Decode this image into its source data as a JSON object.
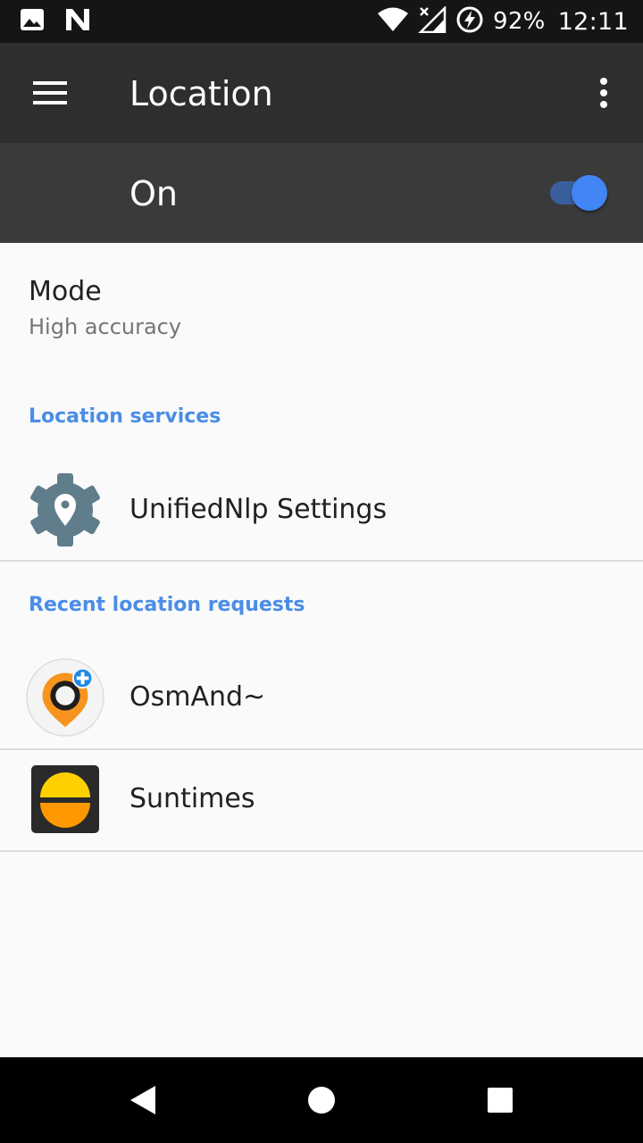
{
  "status_bar": {
    "icons": [
      "image-icon",
      "n-notification-icon",
      "wifi-icon",
      "signal-icon",
      "battery-charging-icon"
    ],
    "battery": "92%",
    "time": "12:11"
  },
  "app_bar": {
    "title": "Location",
    "menu_icon": "hamburger-menu-icon",
    "overflow_icon": "more-vert-icon"
  },
  "master_switch": {
    "label": "On",
    "state": "on",
    "accent": "#4285f4"
  },
  "mode": {
    "title": "Mode",
    "value": "High accuracy"
  },
  "location_services": {
    "header": "Location services",
    "items": [
      {
        "label": "UnifiedNlp Settings",
        "icon": "gear-location-icon"
      }
    ]
  },
  "recent_requests": {
    "header": "Recent location requests",
    "items": [
      {
        "label": "OsmAnd~",
        "icon": "osmand-icon"
      },
      {
        "label": "Suntimes",
        "icon": "suntimes-icon"
      }
    ]
  },
  "colors": {
    "section_header": "#4a8de8",
    "app_bar": "#2e2e2e",
    "switch_bar": "#3a3a3a"
  },
  "nav_bar": {
    "buttons": [
      "back-icon",
      "home-icon",
      "recents-icon"
    ]
  }
}
